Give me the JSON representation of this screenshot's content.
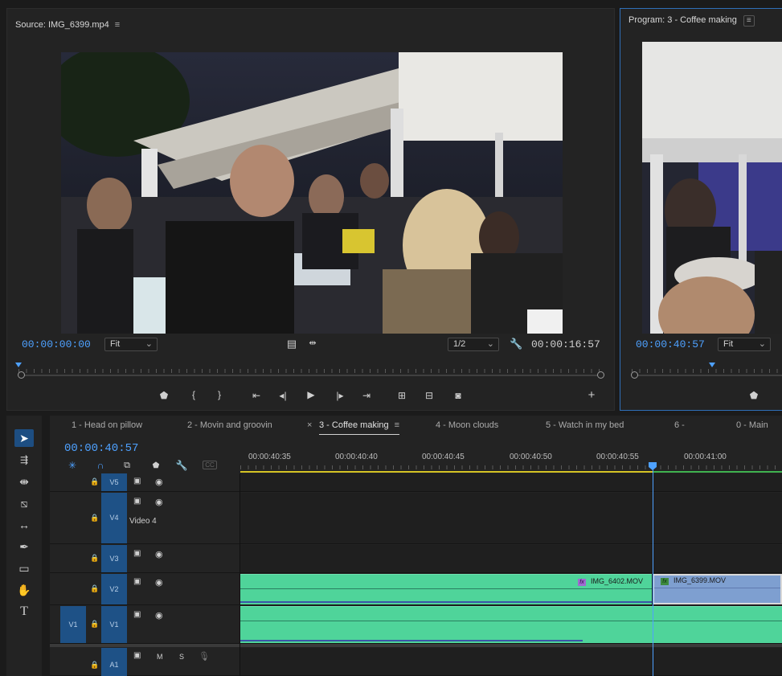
{
  "source_monitor": {
    "title": "Source: IMG_6399.mp4",
    "timecode": "00:00:00:00",
    "fit": "Fit",
    "resolution": "1/2",
    "duration": "00:00:16:57"
  },
  "program_monitor": {
    "title": "Program: 3 -  Coffee making",
    "timecode": "00:00:40:57",
    "fit": "Fit"
  },
  "timeline": {
    "timecode": "00:00:40:57",
    "tabs": [
      {
        "label": "1 - Head on pillow"
      },
      {
        "label": "2 - Movin and groovin"
      },
      {
        "label": "3 - Coffee making"
      },
      {
        "label": "4 -  Moon clouds"
      },
      {
        "label": "5 -  Watch in my bed"
      },
      {
        "label": "6 -"
      },
      {
        "label": "0 - Main"
      }
    ],
    "close_glyph": "×",
    "ruler": [
      "00:00:40:35",
      "00:00:40:40",
      "00:00:40:45",
      "00:00:40:50",
      "00:00:40:55",
      "00:00:41:00"
    ],
    "tracks": {
      "v5": "V5",
      "v4": "V4",
      "v4_name": "Video 4",
      "v3": "V3",
      "v2": "V2",
      "v1": "V1",
      "a1": "A1",
      "source_v1": "V1",
      "mute": "M",
      "solo": "S"
    },
    "clips": {
      "v2_clip_a": "IMG_6402.MOV",
      "v2_clip_b": "IMG_6399.MOV"
    }
  },
  "colors": {
    "accent": "#4ea1ff",
    "clip_green": "#4fd49a",
    "clip_blue": "#7e9fd0",
    "track_blue": "#1e5186"
  },
  "icons": {
    "menu": "≡",
    "chevron": "⌄"
  }
}
